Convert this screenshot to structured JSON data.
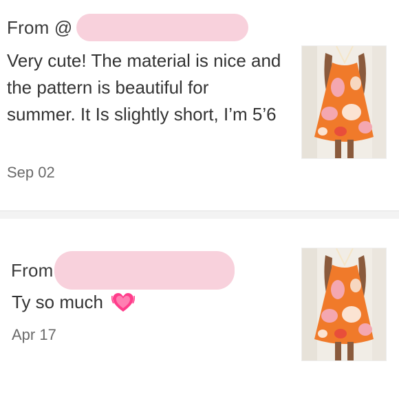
{
  "reviews": [
    {
      "from_label": "From @",
      "text": "Very cute! The material is nice and the pattern is beautiful for summer. It Is slightly short, I’m 5’6",
      "date": "Sep 02",
      "thumbnail_icon": "dress-photo"
    },
    {
      "from_label": "From",
      "text": "Ty so much",
      "emoji": "💓",
      "date": "Apr 17",
      "thumbnail_icon": "dress-photo"
    }
  ],
  "colors": {
    "redaction": "#f8d1dc",
    "divider": "#f3f3f3",
    "dress_orange": "#f07a2a",
    "dress_pink": "#f4a7b0",
    "heart": "#ff3d8b"
  }
}
